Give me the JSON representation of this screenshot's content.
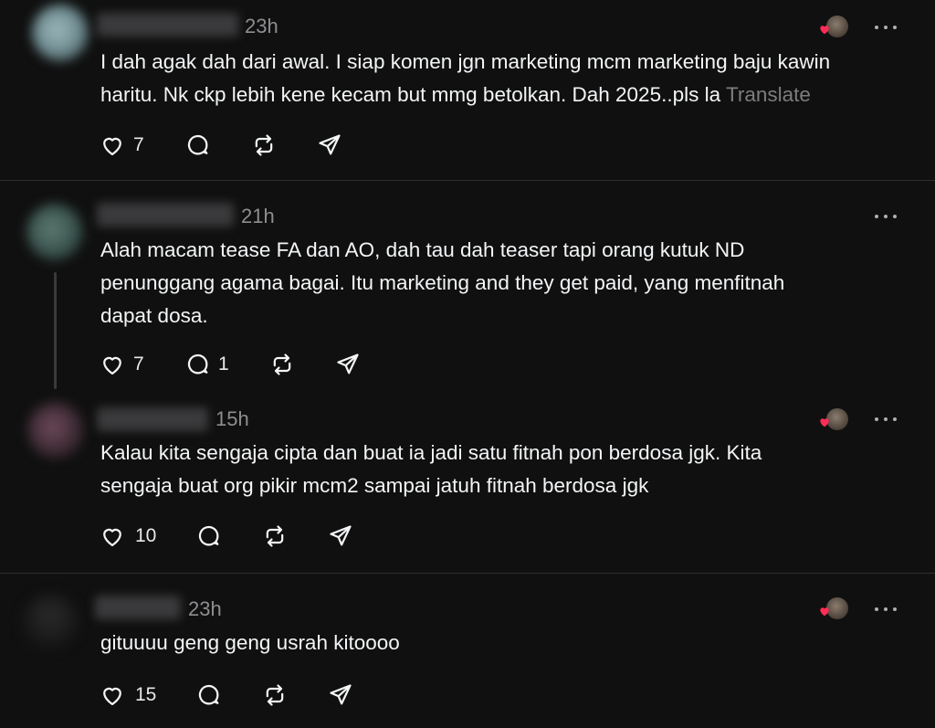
{
  "posts": [
    {
      "time": "23h",
      "lines": [
        "I dah agak dah dari awal. I siap komen jgn marketing mcm marketing baju kawin",
        "haritu. Nk ckp lebih kene kecam but mmg betolkan. Dah 2025..pls la "
      ],
      "translate": "Translate",
      "likes": "7",
      "replies": "",
      "liked_by_author": true
    },
    {
      "time": "21h",
      "lines": [
        "Alah macam tease FA dan AO, dah tau dah teaser tapi orang kutuk ND",
        "penunggang agama bagai. Itu marketing and they get paid, yang menfitnah",
        "dapat dosa."
      ],
      "likes": "7",
      "replies": "1",
      "liked_by_author": false
    },
    {
      "time": "15h",
      "lines": [
        "Kalau kita sengaja cipta dan buat ia jadi satu fitnah pon berdosa jgk. Kita",
        "sengaja buat org pikir mcm2 sampai jatuh fitnah berdosa jgk"
      ],
      "likes": "10",
      "replies": "",
      "liked_by_author": true
    },
    {
      "time": "23h",
      "lines": [
        "gituuuu geng geng usrah kitoooo"
      ],
      "likes": "15",
      "replies": "",
      "liked_by_author": true
    }
  ],
  "icons": {
    "like": "heart-outline-icon",
    "reply": "speech-bubble-icon",
    "repost": "repost-icon",
    "share": "paper-plane-icon",
    "more": "more-dots-icon",
    "liked_badge": "author-liked-heart-icon"
  },
  "colors": {
    "background": "#101010",
    "text": "#f3f5f7",
    "muted": "#8e8e92",
    "liked_heart": "#ff2d55"
  }
}
